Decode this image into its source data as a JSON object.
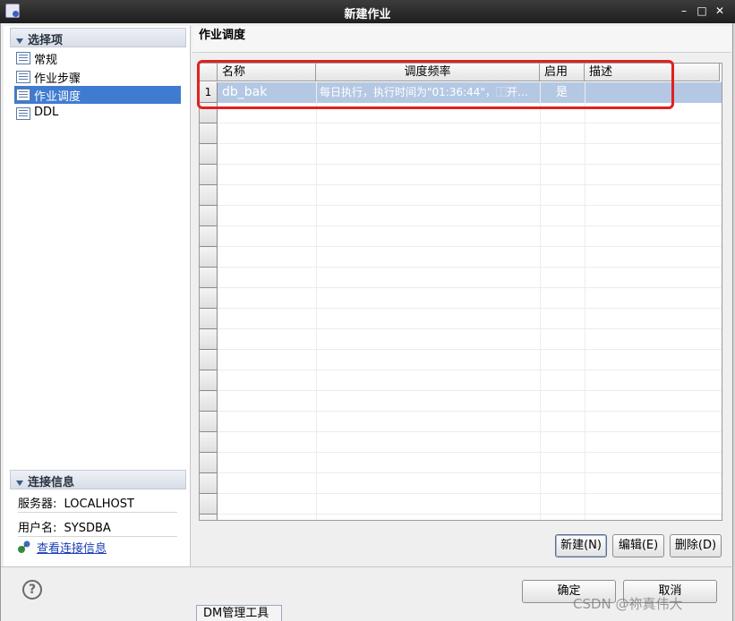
{
  "window": {
    "title": "新建作业",
    "minimize": "–",
    "maximize": "□",
    "close": "✕"
  },
  "sidebar": {
    "header": "选择项",
    "items": [
      {
        "label": "常规"
      },
      {
        "label": "作业步骤"
      },
      {
        "label": "作业调度"
      },
      {
        "label": "DDL"
      }
    ],
    "selected": "作业调度"
  },
  "connection": {
    "header": "连接信息",
    "server_label": "服务器:",
    "server_value": "LOCALHOST",
    "user_label": "用户名:",
    "user_value": "SYSDBA",
    "link": "查看连接信息"
  },
  "page": {
    "title": "作业调度"
  },
  "table": {
    "columns": [
      "名称",
      "调度频率",
      "启用",
      "描述"
    ],
    "rows": [
      {
        "num": "1",
        "name": "db_bak",
        "frequency": "每日执行，执行时间为\"01:36:44\"，⿰开…",
        "enabled": "是",
        "description": ""
      }
    ]
  },
  "buttons": {
    "new": "新建(N)",
    "edit": "编辑(E)",
    "delete": "删除(D)",
    "ok": "确定",
    "cancel": "取消"
  },
  "taskbar": {
    "tab": "DM管理工具"
  },
  "watermark": "CSDN @祢真伟大",
  "colors": {
    "selection": "#3f7bd0",
    "row_selection": "#b4c8e4",
    "highlight_box": "#e0211f",
    "link": "#1a3fb8"
  }
}
